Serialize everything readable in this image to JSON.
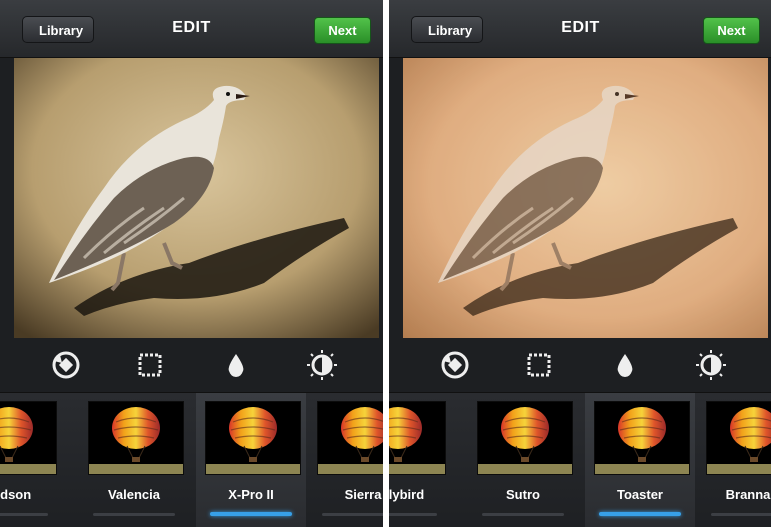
{
  "screens": [
    {
      "back_label": "Library",
      "title": "EDIT",
      "next_label": "Next",
      "filters": [
        "Hudson",
        "Valencia",
        "X-Pro II",
        "Sierra"
      ],
      "selected_filter": "X-Pro II"
    },
    {
      "back_label": "Library",
      "title": "EDIT",
      "next_label": "Next",
      "filters": [
        "Earlybird",
        "Sutro",
        "Toaster",
        "Brannan"
      ],
      "selected_filter": "Toaster"
    }
  ],
  "tools": [
    "rotate-icon",
    "frame-icon",
    "blur-drop-icon",
    "lux-sun-icon"
  ],
  "colors": {
    "next_green": "#34a83a",
    "active_bar": "#37a0e8"
  }
}
